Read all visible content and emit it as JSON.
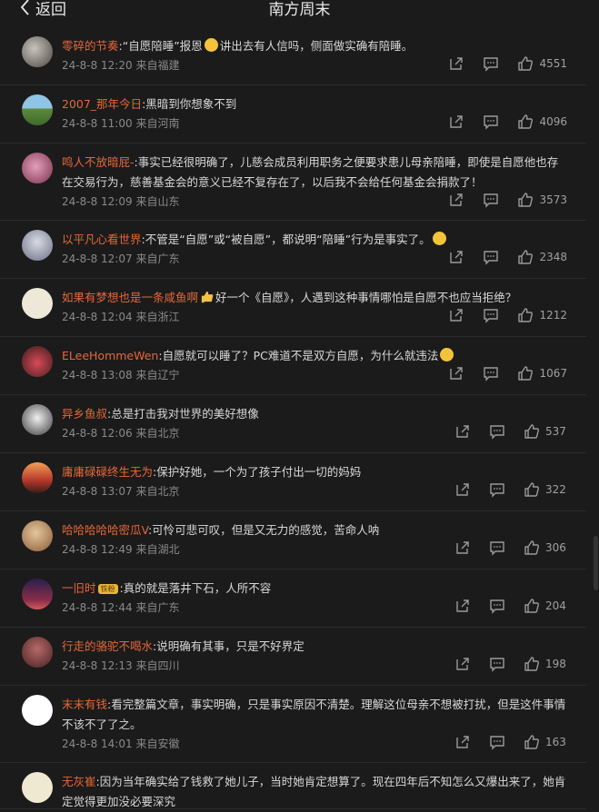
{
  "nav": {
    "back_label": "返回",
    "title": "南方周末"
  },
  "colors": {
    "username": "#e5673a",
    "background": "#1b1b1b"
  },
  "comments": [
    {
      "user": "零碎的节奏",
      "text": ":“自愿陪睡”报恩",
      "text2": "讲出去有人信吗，侧面做实确有陪睡。",
      "emoji": "laughing-face",
      "date": "24-8-8 12:20",
      "origin": "来自福建",
      "likes": "4551"
    },
    {
      "user": "2007_那年今日",
      "text": ":黑暗到你想象不到",
      "date": "24-8-8 11:00",
      "origin": "来自河南",
      "likes": "4096"
    },
    {
      "user": "鸣人不放暗屁-",
      "text": ":事实已经很明确了，儿慈会成员利用职务之便要求患儿母亲陪睡，即使是自愿他也存在交易行为，慈善基金会的意义已经不复存在了，以后我不会给任何基金会捐款了！",
      "date": "24-8-8 12:09",
      "origin": "来自山东",
      "likes": "3573"
    },
    {
      "user": "以平凡心看世界",
      "text": ":不管是“自愿”或“被自愿”，都说明“陪睡”行为是事实了。",
      "emoji": "thinking-face",
      "date": "24-8-8 12:07",
      "origin": "来自广东",
      "likes": "2348"
    },
    {
      "user": "如果有梦想也是一条咸鱼啊",
      "text": "好一个《自愿》，人遇到这种事情哪怕是自愿不也应当拒绝？",
      "emoji": "thumbs-up",
      "date": "24-8-8 12:04",
      "origin": "来自浙江",
      "likes": "1212"
    },
    {
      "user": "ELeeHommeWen",
      "text": ":自愿就可以睡了？PC难道不是双方自愿，为什么就违法",
      "emoji": "shrug-face",
      "date": "24-8-8 13:08",
      "origin": "来自辽宁",
      "likes": "1067"
    },
    {
      "user": "异乡鱼叔",
      "text": ":总是打击我对世界的美好想像",
      "date": "24-8-8 12:06",
      "origin": "来自北京",
      "likes": "537"
    },
    {
      "user": "庸庸碌碌终生无为",
      "text": ":保护好她，一个为了孩子付出一切的妈妈",
      "date": "24-8-8 13:07",
      "origin": "来自北京",
      "likes": "322"
    },
    {
      "user": "哈哈哈哈哈密瓜V",
      "text": ":可怜可悲可叹，但是又无力的感觉，苦命人呐",
      "date": "24-8-8 12:49",
      "origin": "来自湖北",
      "likes": "306"
    },
    {
      "user": "一旧时",
      "badge": "铁粉",
      "text": ":真的就是落井下石，人所不容",
      "date": "24-8-8 12:44",
      "origin": "来自广东",
      "likes": "204"
    },
    {
      "user": "行走的骆驼不喝水",
      "text": ":说明确有其事，只是不好界定",
      "date": "24-8-8 12:13",
      "origin": "来自四川",
      "likes": "198"
    },
    {
      "user": "末末有钱",
      "text": ":看完整篇文章，事实明确，只是事实原因不清楚。理解这位母亲不想被打扰，但是这件事情不该不了了之。",
      "date": "24-8-8 14:01",
      "origin": "来自安徽",
      "likes": "163"
    },
    {
      "user": "无灰崔",
      "text": ":因为当年确实给了钱救了她儿子，当时她肯定想算了。现在四年后不知怎么又爆出来了，她肯定觉得更加没必要深究",
      "date": "",
      "origin": "",
      "likes": ""
    }
  ]
}
